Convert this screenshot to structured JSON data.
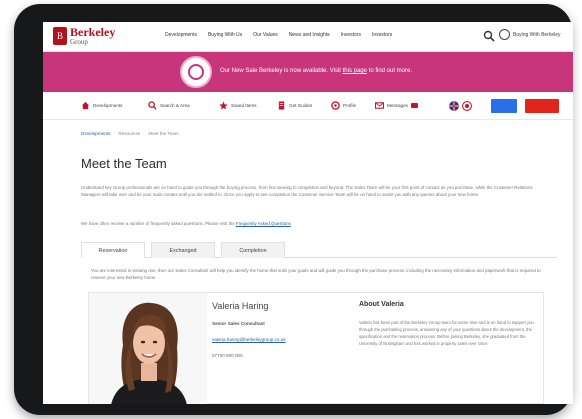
{
  "brand": {
    "name": "Berkeley",
    "sub": "Group",
    "badge_letter": "B"
  },
  "topnav": {
    "links": [
      "Developments",
      "Buying With Us",
      "Our Values",
      "News and Insights",
      "Investors",
      "Investors"
    ],
    "user_label": "Buying With Berkeley"
  },
  "banner": {
    "text_before": "Our New Sale Berkeley is now available. Visit ",
    "link_text": "this page",
    "text_after": " to find out more."
  },
  "subnav": {
    "items": [
      "Developments",
      "Search & Area",
      "Saved Items",
      "Get Guides",
      "Profile",
      "Messages"
    ]
  },
  "breadcrumb": [
    "Developments",
    "Resources",
    "Meet the Team"
  ],
  "page_title": "Meet the Team",
  "intro_text": "Understand key Group professionals are on hand to guide you through the buying process, from first viewing to completion and beyond. The Sales Team will be your first point of contact as you purchase, while the Customer Relations Managers will take over and be your main contact until you are settled in. Once you apply to see completion the Customer Service Team will be on hand to assist you with any queries about your new home.",
  "intro_text2_before": "We have often receive a number of frequently asked questions. Please visit the ",
  "intro_text2_link": "Frequently Asked Questions",
  "tabs": [
    "Reservation",
    "Exchanged",
    "Completion"
  ],
  "tab_description": "You are interested in viewing one, then our Sales Consultant will help you identify the home that suits your goals and will guide you through the purchase process, including the necessary information and paperwork that is required to reserve your new Berkeley home.",
  "profile": {
    "name": "Valeria Haring",
    "role": "Senior Sales Consultant",
    "email": "valeria.haring@berkeleygroup.co.uk",
    "phone": "07700 900 000",
    "about_title": "About Valeria",
    "about_body": "Valeria has been part of the Berkeley Group team for some time and is on hand to support you through the purchasing process, answering any of your questions about the development, the specification and the reservation process. Before joining Berkeley, she graduated from the University of Nottingham and has worked in property sales ever since."
  },
  "colors": {
    "brand_red": "#b1121c",
    "banner_pink": "#c8357a",
    "accent_blue": "#2a6ee8",
    "cta_red": "#e1251b"
  }
}
